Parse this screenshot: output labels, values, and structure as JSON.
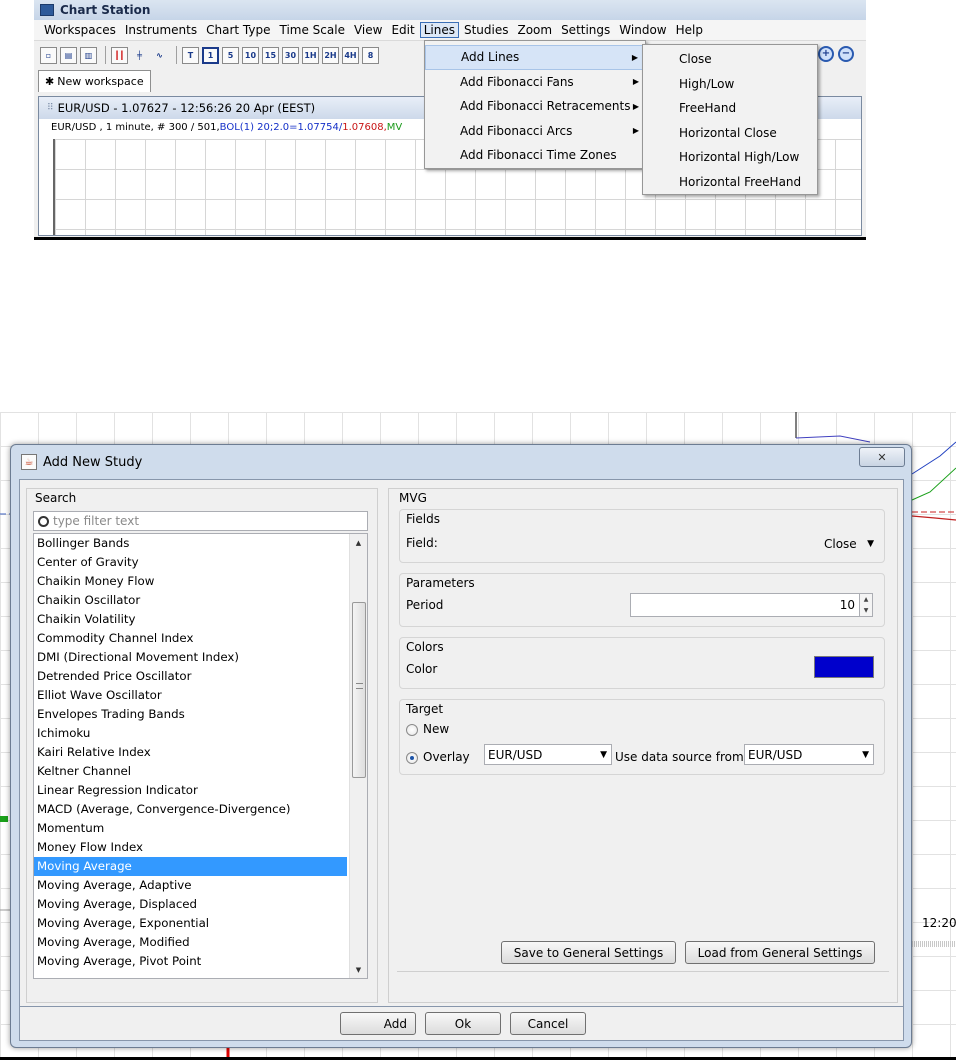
{
  "top": {
    "app_title": "Chart Station",
    "menu": [
      "Workspaces",
      "Instruments",
      "Chart Type",
      "Time Scale",
      "View",
      "Edit",
      "Lines",
      "Studies",
      "Zoom",
      "Settings",
      "Window",
      "Help"
    ],
    "active_menu": "Lines",
    "toolbar_timescales": [
      "T",
      "1",
      "5",
      "10",
      "15",
      "30",
      "1H",
      "2H",
      "4H",
      "8"
    ],
    "workspace_tab": "New workspace",
    "workspace_tab_icon": "✱",
    "chart_title": "EUR/USD - 1.07627 - 12:56:26  20 Apr (EEST)",
    "chart_info": {
      "base": "EUR/USD , 1 minute, # 300 / 501, ",
      "bol": "BOL(1) 20;2.0=1.07754/",
      "bol_low": "1.07608, ",
      "mv": "MV",
      "colors": {
        "bol": "#1530c8",
        "bol_low": "#c81515",
        "mv": "#1a9a1a"
      }
    },
    "lines_menu": [
      {
        "label": "Add Lines",
        "has_submenu": true,
        "highlighted": true
      },
      {
        "label": "Add Fibonacci Fans",
        "has_submenu": true
      },
      {
        "label": "Add Fibonacci Retracements",
        "has_submenu": true
      },
      {
        "label": "Add Fibonacci Arcs",
        "has_submenu": true
      },
      {
        "label": "Add Fibonacci Time Zones",
        "has_submenu": false
      }
    ],
    "add_lines_submenu": [
      "Close",
      "High/Low",
      "FreeHand",
      "Horizontal Close",
      "Horizontal High/Low",
      "Horizontal FreeHand"
    ]
  },
  "dialog": {
    "title": "Add New Study",
    "close_glyph": "✕",
    "search_label": "Search",
    "search_placeholder": "type filter text",
    "studies": [
      "Bollinger Bands",
      "Center of Gravity",
      "Chaikin Money Flow",
      "Chaikin Oscillator",
      "Chaikin Volatility",
      "Commodity Channel Index",
      "DMI (Directional Movement Index)",
      "Detrended Price Oscillator",
      "Elliot Wave Oscillator",
      "Envelopes Trading Bands",
      "Ichimoku",
      "Kairi Relative Index",
      "Keltner Channel",
      "Linear Regression Indicator",
      "MACD (Average, Convergence-Divergence)",
      "Momentum",
      "Money Flow Index",
      "Moving Average",
      "Moving Average, Adaptive",
      "Moving Average, Displaced",
      "Moving Average, Exponential",
      "Moving Average, Modified",
      "Moving Average, Pivot Point"
    ],
    "selected_study": "Moving Average",
    "settings_title": "MVG",
    "fields_group": "Fields",
    "field_label": "Field:",
    "field_value": "Close",
    "parameters_group": "Parameters",
    "period_label": "Period",
    "period_value": "10",
    "colors_group": "Colors",
    "color_label": "Color",
    "color_value": "#0000cc",
    "target_group": "Target",
    "target_new": "New",
    "target_overlay": "Overlay",
    "target_selected": "Overlay",
    "overlay_instrument": "EUR/USD",
    "data_source_label": "Use data source from",
    "data_source_value": "EUR/USD",
    "save_settings_btn": "Save to General Settings",
    "load_settings_btn": "Load from General Settings",
    "add_btn": "Add",
    "ok_btn": "Ok",
    "cancel_btn": "Cancel"
  },
  "background_chart": {
    "time_label": "12:20"
  },
  "colors": {
    "selection": "#3399ff",
    "dialog_frame": "#cfdcec"
  }
}
